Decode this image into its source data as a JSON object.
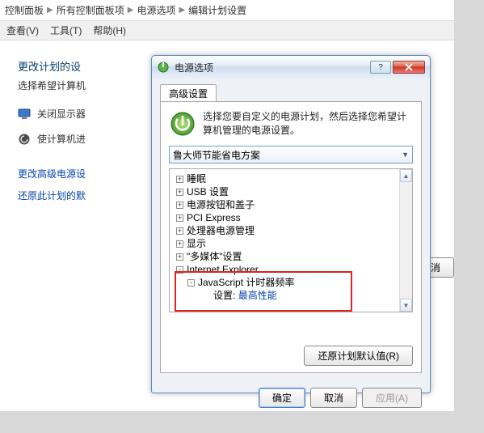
{
  "breadcrumb": [
    "控制面板",
    "所有控制面板项",
    "电源选项",
    "编辑计划设置"
  ],
  "menubar": {
    "view": "查看(V)",
    "tools": "工具(T)",
    "help": "帮助(H)"
  },
  "page": {
    "heading": "更改计划的设",
    "subtitle": "选择希望计算机",
    "opt_display": "关闭显示器",
    "opt_sleep": "使计算机进",
    "link_adv": "更改高级电源设",
    "link_restore": "还原此计划的默",
    "cancel": "取消"
  },
  "dialog": {
    "title": "电源选项",
    "tab": "高级设置",
    "intro": "选择您要自定义的电源计划，然后选择您希望计算机管理的电源设置。",
    "dropdown": "鲁大师节能省电方案",
    "tree": {
      "hibernate": "睡眠",
      "usb": "USB 设置",
      "powerbtn": "电源按钮和盖子",
      "pci": "PCI Express",
      "cpu": "处理器电源管理",
      "display": "显示",
      "media": "\"多媒体\"设置",
      "ie": "Internet Explorer",
      "jsfreq": "JavaScript 计时器频率",
      "setting_label": "设置:",
      "setting_value": "最高性能"
    },
    "restore_defaults": "还原计划默认值(R)",
    "ok": "确定",
    "cancel": "取消",
    "apply": "应用(A)"
  }
}
